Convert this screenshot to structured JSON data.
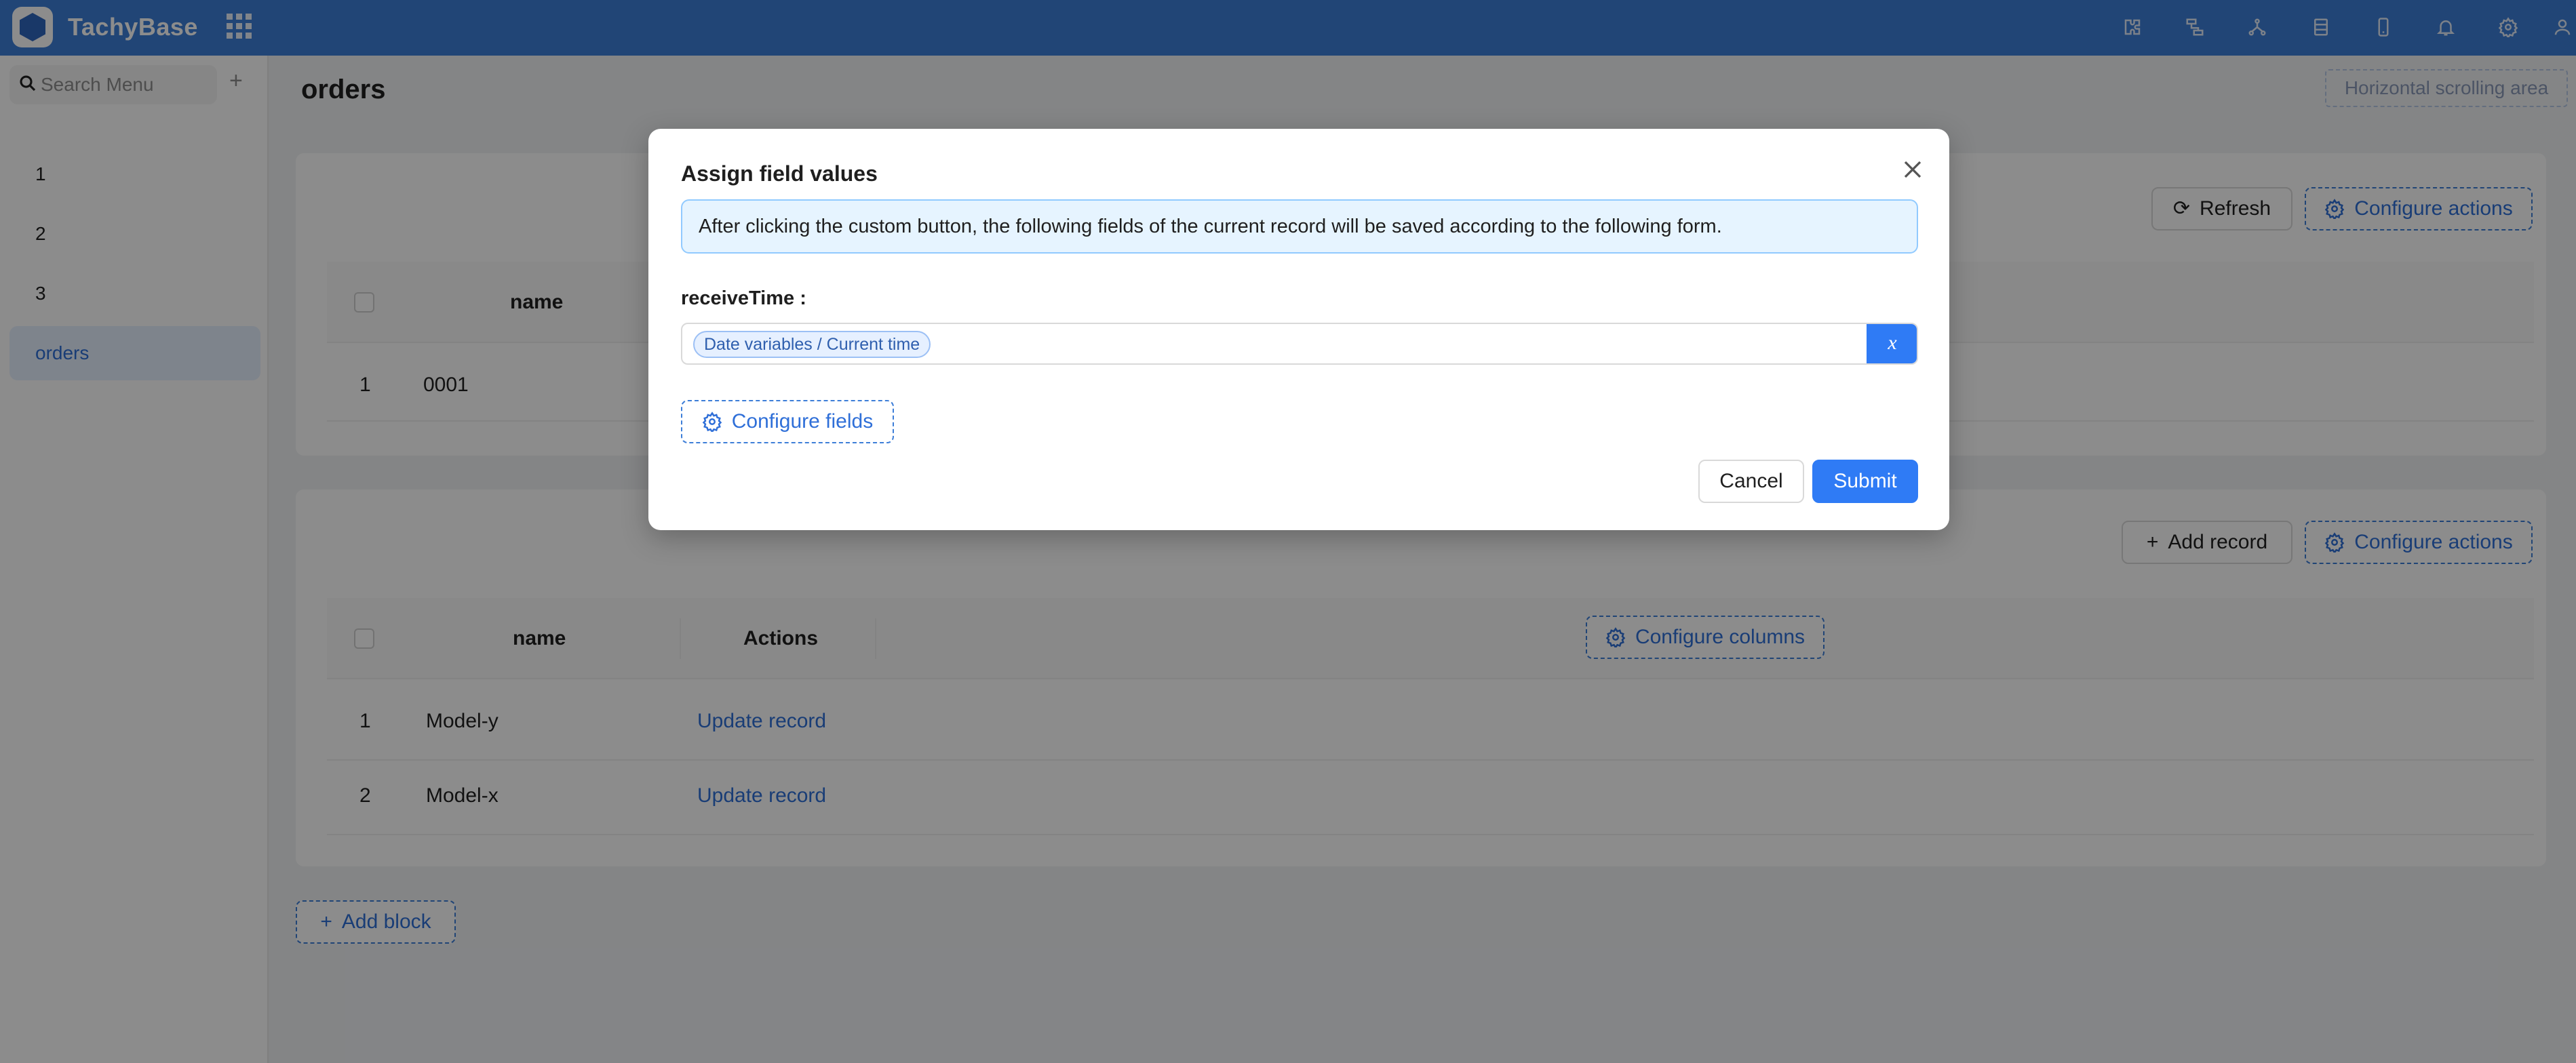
{
  "app": {
    "brand": "TachyBase"
  },
  "header": {
    "icons": [
      "puzzle-icon",
      "workflow-icon",
      "graph-icon",
      "database-icon",
      "mobile-icon",
      "bell-icon",
      "gear-icon",
      "user-icon"
    ]
  },
  "sidebar": {
    "search_placeholder": "Search Menu",
    "items": [
      {
        "label": "1"
      },
      {
        "label": "2"
      },
      {
        "label": "3"
      },
      {
        "label": "orders"
      }
    ]
  },
  "page": {
    "title": "orders",
    "scroll_area_label": "Horizontal scrolling area"
  },
  "block1": {
    "refresh_label": "Refresh",
    "configure_actions_label": "Configure actions",
    "columns": [
      "name"
    ],
    "rows": [
      {
        "index": "1",
        "name": "0001"
      }
    ]
  },
  "block2": {
    "add_record_label": "Add record",
    "configure_actions_label": "Configure actions",
    "columns": [
      "name",
      "Actions"
    ],
    "configure_columns_label": "Configure columns",
    "rows": [
      {
        "index": "1",
        "name": "Model-y",
        "action": "Update record"
      },
      {
        "index": "2",
        "name": "Model-x",
        "action": "Update record"
      }
    ]
  },
  "add_block_label": "Add block",
  "modal": {
    "title": "Assign field values",
    "notice": "After clicking the custom button, the following fields of the current record will be saved according to the following form.",
    "field_label": "receiveTime",
    "field_value_tag": "Date variables / Current time",
    "variable_button": "x",
    "configure_fields_label": "Configure fields",
    "cancel_label": "Cancel",
    "submit_label": "Submit"
  },
  "colors": {
    "header_bg": "#3d7ed8",
    "primary": "#2f7bf5",
    "link": "#2f6fd8",
    "overlay": "rgba(0,0,0,0.45)"
  }
}
